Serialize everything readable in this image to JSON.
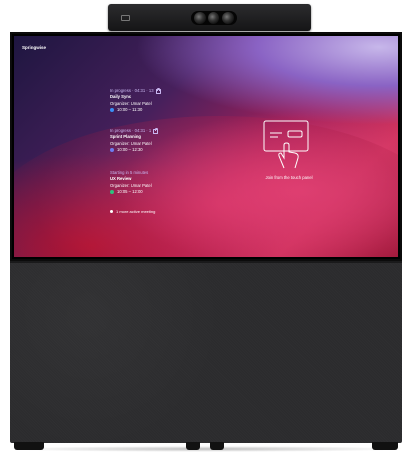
{
  "location": "Springwise",
  "meetings": [
    {
      "status": "In progress · 04:31 · 13",
      "title": "Daily Sync",
      "organizer": "Organizer: Umar Patel",
      "time": "10:00 – 11:30",
      "app_icon": "webex-icon",
      "app_color": "#3b8ff5"
    },
    {
      "status": "In progress · 04:31 · 1",
      "title": "Sprint Planning",
      "organizer": "Organizer: Umar Patel",
      "time": "10:00 – 12:30",
      "app_icon": "teams-icon",
      "app_color": "#6e7cf0"
    },
    {
      "status": "Starting in 5 minutes",
      "title": "UX Review",
      "organizer": "Organizer: Umar Patel",
      "time": "10:05 – 12:00",
      "app_icon": "zoom-icon",
      "app_color": "#2ec27e"
    }
  ],
  "more_meetings": "1 more active meeting",
  "join_text": "Join from the touch panel",
  "colors": {
    "status_accent": "#c9b7f0",
    "text": "#ffffff"
  }
}
